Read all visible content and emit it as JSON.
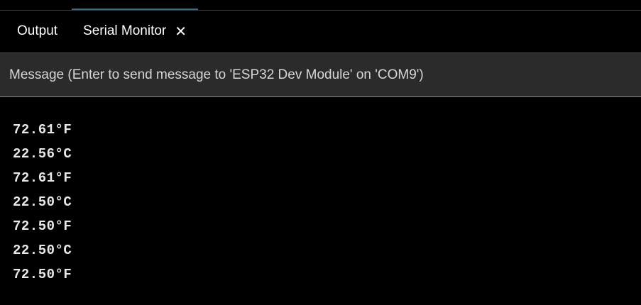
{
  "tabs": [
    {
      "label": "Output"
    },
    {
      "label": "Serial Monitor",
      "close_icon": "close-icon",
      "active": true
    }
  ],
  "message": {
    "placeholder": "Message (Enter to send message to 'ESP32 Dev Module' on 'COM9')",
    "value": ""
  },
  "output": {
    "lines": [
      "72.61°F",
      "22.56°C",
      "72.61°F",
      "22.50°C",
      "72.50°F",
      "22.50°C",
      "72.50°F"
    ]
  },
  "colors": {
    "background": "#000000",
    "message_bar": "#2b2b2b",
    "text": "#ffffff",
    "active_tab_indicator": "#3b6a86"
  }
}
